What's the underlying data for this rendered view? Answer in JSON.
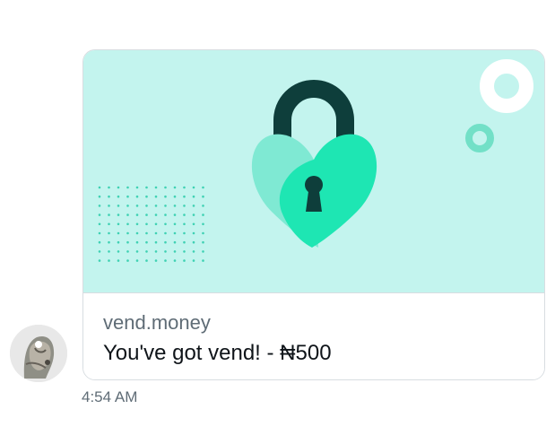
{
  "message": {
    "card": {
      "image_icon": "heart-padlock-icon",
      "domain": "vend.money",
      "title": "You've got vend! - ₦500"
    },
    "timestamp": "4:54 AM",
    "avatar_icon": "user-avatar-icon"
  },
  "colors": {
    "card_background": "#c3f4ee",
    "lock_shackle": "#0e3e3b",
    "heart_dark": "#1ee6b3",
    "heart_light": "#7fe9d3",
    "dots": "#3fd1b3",
    "meta_text": "#5f6c76",
    "title_text": "#0f1419"
  }
}
